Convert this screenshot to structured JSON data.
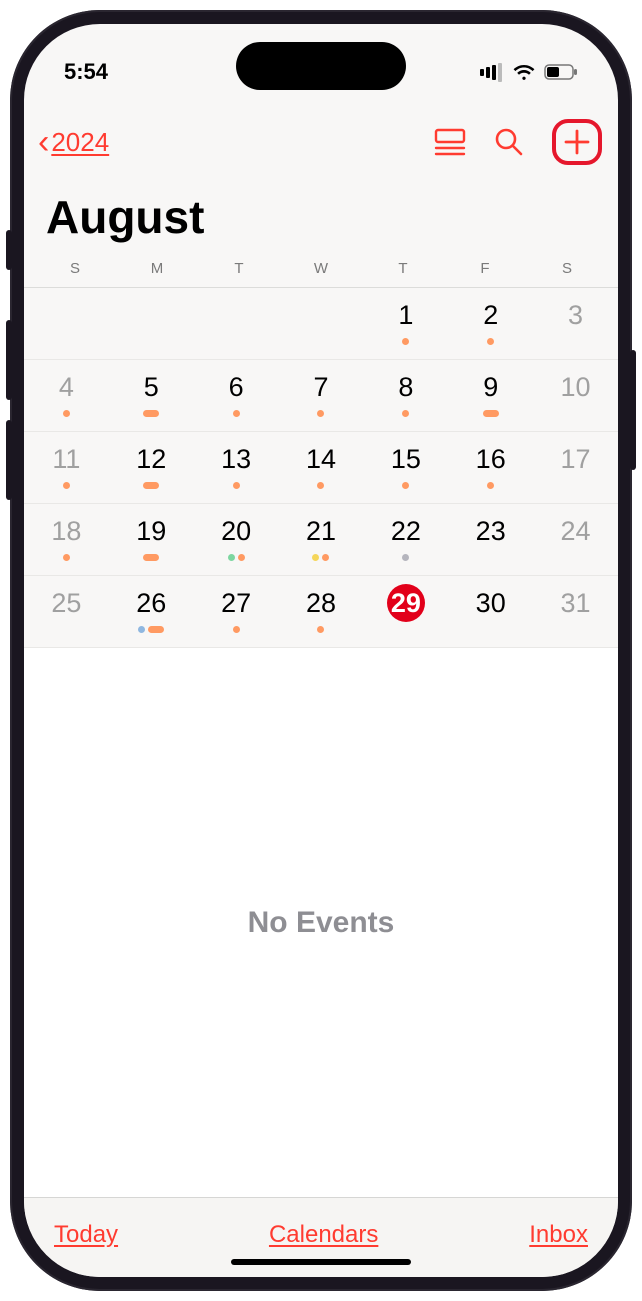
{
  "status": {
    "time": "5:54"
  },
  "nav": {
    "year": "2024"
  },
  "month": "August",
  "weekdays": [
    "S",
    "M",
    "T",
    "W",
    "T",
    "F",
    "S"
  ],
  "today": 29,
  "weeks": [
    [
      {
        "n": "",
        "dots": []
      },
      {
        "n": "",
        "dots": []
      },
      {
        "n": "",
        "dots": []
      },
      {
        "n": "",
        "dots": []
      },
      {
        "n": 1,
        "dots": [
          "orange"
        ]
      },
      {
        "n": 2,
        "dots": [
          "orange"
        ]
      },
      {
        "n": 3,
        "we": true,
        "dots": []
      }
    ],
    [
      {
        "n": 4,
        "we": true,
        "dots": [
          "orange"
        ]
      },
      {
        "n": 5,
        "dots": [
          "orange pill"
        ]
      },
      {
        "n": 6,
        "dots": [
          "orange"
        ]
      },
      {
        "n": 7,
        "dots": [
          "orange"
        ]
      },
      {
        "n": 8,
        "dots": [
          "orange"
        ]
      },
      {
        "n": 9,
        "dots": [
          "orange pill"
        ]
      },
      {
        "n": 10,
        "we": true,
        "dots": []
      }
    ],
    [
      {
        "n": 11,
        "we": true,
        "dots": [
          "orange"
        ]
      },
      {
        "n": 12,
        "dots": [
          "orange pill"
        ]
      },
      {
        "n": 13,
        "dots": [
          "orange"
        ]
      },
      {
        "n": 14,
        "dots": [
          "orange"
        ]
      },
      {
        "n": 15,
        "dots": [
          "orange"
        ]
      },
      {
        "n": 16,
        "dots": [
          "orange"
        ]
      },
      {
        "n": 17,
        "we": true,
        "dots": []
      }
    ],
    [
      {
        "n": 18,
        "we": true,
        "dots": [
          "orange"
        ]
      },
      {
        "n": 19,
        "dots": [
          "orange pill"
        ]
      },
      {
        "n": 20,
        "dots": [
          "green",
          "orange"
        ]
      },
      {
        "n": 21,
        "dots": [
          "yellow",
          "orange"
        ]
      },
      {
        "n": 22,
        "dots": [
          "gray"
        ]
      },
      {
        "n": 23,
        "dots": []
      },
      {
        "n": 24,
        "we": true,
        "dots": []
      }
    ],
    [
      {
        "n": 25,
        "we": true,
        "dots": []
      },
      {
        "n": 26,
        "dots": [
          "blue",
          "orange pill"
        ]
      },
      {
        "n": 27,
        "dots": [
          "orange"
        ]
      },
      {
        "n": 28,
        "dots": [
          "orange"
        ]
      },
      {
        "n": 29,
        "dots": []
      },
      {
        "n": 30,
        "dots": []
      },
      {
        "n": 31,
        "we": true,
        "dots": []
      }
    ]
  ],
  "events_empty": "No Events",
  "toolbar": {
    "today": "Today",
    "calendars": "Calendars",
    "inbox": "Inbox"
  }
}
